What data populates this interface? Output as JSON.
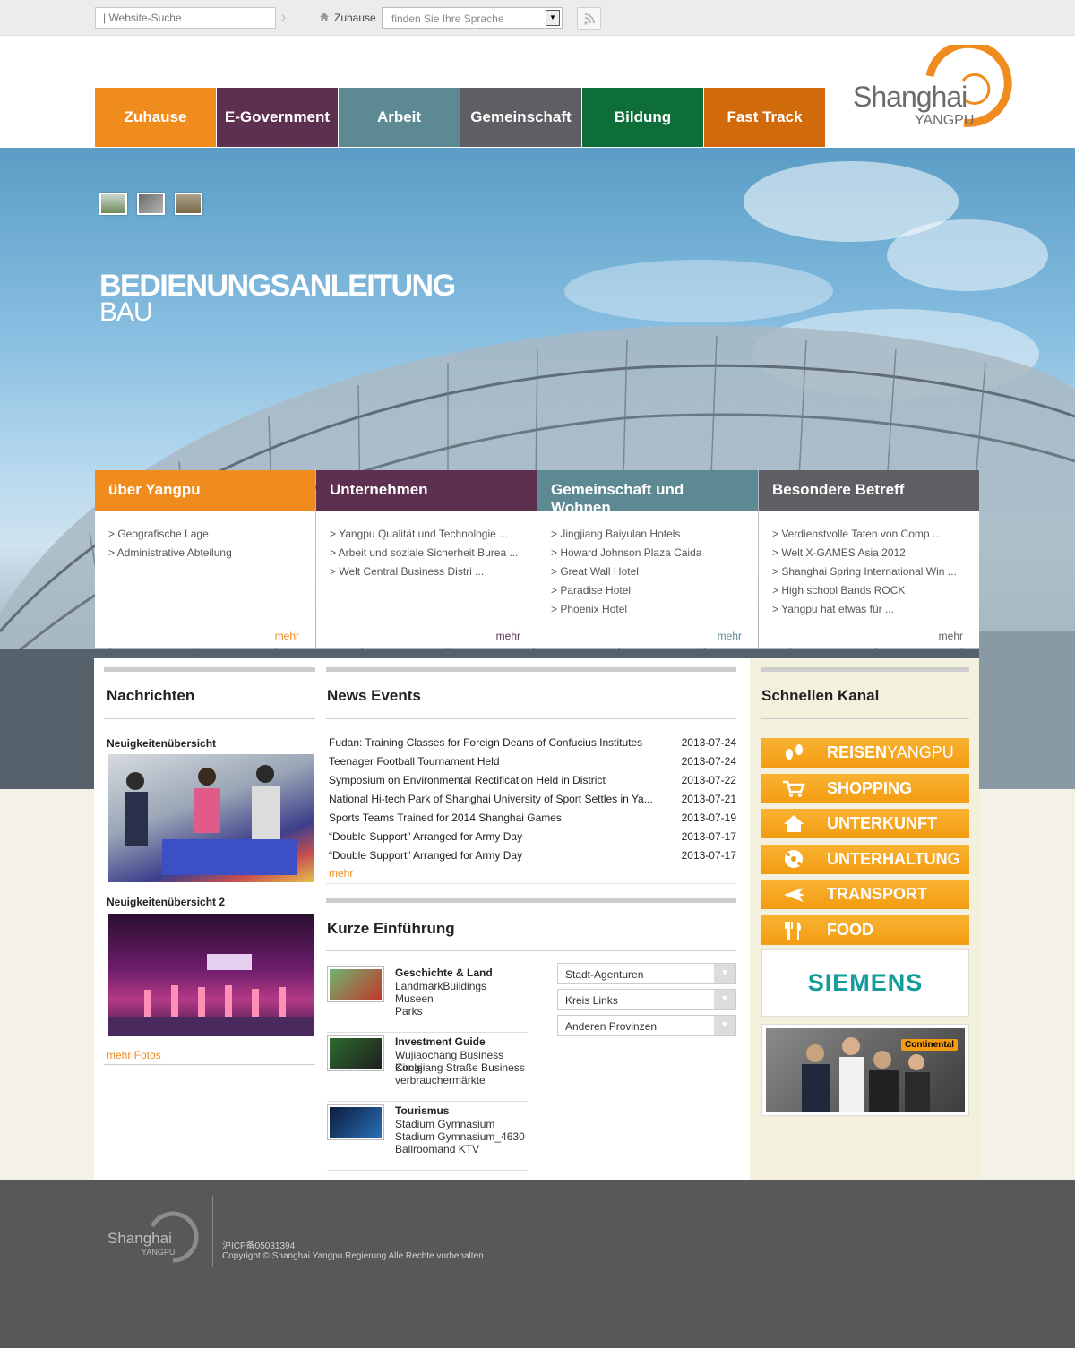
{
  "topbar": {
    "search_placeholder": "| Website-Suche",
    "home_label": "Zuhause",
    "language_placeholder": "finden Sie Ihre Sprache"
  },
  "nav": [
    {
      "label": "Zuhause",
      "color": "#f08b1d"
    },
    {
      "label": "E-Government",
      "color": "#5e3050"
    },
    {
      "label": "Arbeit",
      "color": "#5d8a92"
    },
    {
      "label": "Gemeinschaft",
      "color": "#5f5f63"
    },
    {
      "label": "Bildung",
      "color": "#0e6e3a"
    },
    {
      "label": "Fast Track",
      "color": "#d06a0b"
    }
  ],
  "logo": {
    "line1": "Shanghai",
    "line2": "YANGPU"
  },
  "hero": {
    "title": "BEDIENUNGSANLEITUNG",
    "subtitle": "BAU"
  },
  "categories": [
    {
      "title": "über Yangpu",
      "color": "#f08b1d",
      "more_color": "#f08b1d",
      "more": "mehr",
      "items": [
        "> Geografische Lage",
        "> Administrative Abteilung"
      ]
    },
    {
      "title": "Unternehmen",
      "color": "#5e3050",
      "more_color": "#5e3050",
      "more": "mehr",
      "items": [
        "> Yangpu Qualität und Technologie ...",
        "> Arbeit und soziale Sicherheit Burea ...",
        "> Welt Central Business Distri ..."
      ]
    },
    {
      "title": "Gemeinschaft und Wohnen",
      "color": "#5d8a92",
      "more_color": "#5d8a92",
      "more": "mehr",
      "items": [
        "> Jingjiang Baiyulan Hotels",
        "> Howard Johnson Plaza Caida",
        "> Great Wall Hotel",
        "> Paradise Hotel",
        "> Phoenix Hotel"
      ]
    },
    {
      "title": "Besondere Betreff",
      "color": "#5f5f63",
      "more_color": "#5f5f63",
      "more": "mehr",
      "items": [
        "> Verdienstvolle Taten von Comp ...",
        "> Welt X-GAMES Asia 2012",
        "> Shanghai Spring International Win ...",
        "> High school Bands ROCK",
        "> Yangpu hat etwas für ..."
      ]
    }
  ],
  "nachrichten": {
    "title": "Nachrichten",
    "photo1_caption": "Neuigkeitenübersicht",
    "photo2_caption": "Neuigkeitenübersicht 2",
    "more": "mehr Fotos"
  },
  "news_events": {
    "title": "News Events",
    "more": "mehr",
    "items": [
      {
        "title": "Fudan: Training Classes for Foreign Deans of Confucius Institutes",
        "date": "2013-07-24"
      },
      {
        "title": "Teenager Football Tournament Held",
        "date": "2013-07-24"
      },
      {
        "title": "Symposium on Environmental Rectification Held in District",
        "date": "2013-07-22"
      },
      {
        "title": "National Hi-tech Park of Shanghai University of Sport Settles in Ya...",
        "date": "2013-07-21"
      },
      {
        "title": "Sports Teams Trained for 2014 Shanghai Games",
        "date": "2013-07-19"
      },
      {
        "title": "“Double Support” Arranged for Army Day",
        "date": "2013-07-17"
      },
      {
        "title": "“Double Support” Arranged for Army Day",
        "date": "2013-07-17"
      }
    ]
  },
  "intro": {
    "title": "Kurze Einführung",
    "items": [
      {
        "title": "Geschichte & Land",
        "lines": [
          "LandmarkBuildings",
          "Museen",
          "Parks"
        ]
      },
      {
        "title": "Investment Guide",
        "lines": [
          "Wujiaochang Business Circle",
          "Kongjiang Straße Business",
          "verbrauchermärkte"
        ]
      },
      {
        "title": "Tourismus",
        "lines": [
          "Stadium Gymnasium",
          "Stadium Gymnasium_4630",
          "Ballroomand KTV"
        ]
      }
    ],
    "dropdowns": [
      "Stadt-Agenturen",
      "Kreis Links",
      "Anderen Provinzen"
    ]
  },
  "quick": {
    "title": "Schnellen Kanal",
    "items": [
      {
        "label_a": "REISEN",
        "label_b": "YANGPU",
        "icon": "footsteps-icon"
      },
      {
        "label_a": "SHOPPING",
        "label_b": "",
        "icon": "cart-icon"
      },
      {
        "label_a": "UNTERKUNFT",
        "label_b": "",
        "icon": "house-icon"
      },
      {
        "label_a": "UNTERHALTUNG",
        "label_b": "",
        "icon": "ball-icon"
      },
      {
        "label_a": "TRANSPORT",
        "label_b": "",
        "icon": "plane-icon"
      },
      {
        "label_a": "FOOD",
        "label_b": "",
        "icon": "fork-knife-icon"
      }
    ],
    "ad1": "SIEMENS",
    "ad2": "Continental"
  },
  "footer": {
    "logo1": "Shanghai",
    "logo2": "YANGPU",
    "icp": "沪ICP备05031394",
    "copyright": "Copyright © Shanghai Yangpu Regierung Alle Rechte vorbehalten"
  }
}
